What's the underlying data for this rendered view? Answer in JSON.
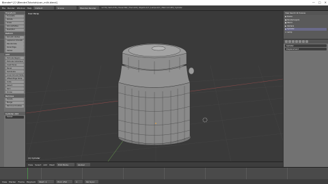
{
  "window": {
    "title": "Blender* [C:\\Blender\\Tutorials\\can_milk.blend]",
    "minimize": "—",
    "maximize": "□",
    "close": "✕"
  },
  "infobar": {
    "menus": [
      "File",
      "Render",
      "Window",
      "Help"
    ],
    "layout": "Default",
    "scene": "Scene",
    "engine": "Blender Render",
    "stats": "v2.79 | Verts:576 | Faces:560 | Tris:1120 | Objects:1/3 | Lamps:0/1 | Mem:12.14M | Cylinder"
  },
  "toolshelf": {
    "sections": [
      {
        "title": "Transform",
        "buttons": [
          "Translate",
          "Rotate",
          "Scale",
          "Shrink/Fatten",
          "Push/Pull"
        ]
      },
      {
        "title": "Deform",
        "buttons": [
          "Smooth Vertex",
          "Laplacian Smooth",
          "Randomize",
          "Slide Edge",
          "Vertex"
        ]
      },
      {
        "title": "Add",
        "buttons": [
          "Extrude Region",
          "Extrude Individual",
          "Inset Faces",
          "Bevel",
          "Subdivide",
          "Loop Cut and Slide",
          "Offset Edge Slide",
          "Knife",
          "Select",
          "Spin",
          "Screw"
        ]
      },
      {
        "title": "Remove",
        "buttons": [
          "Delete",
          "Merge",
          "Remove Doubles"
        ]
      }
    ],
    "operator_panel": "Cylinder Add",
    "operator_value": "Cursor"
  },
  "viewport": {
    "view_label": "User Persp",
    "object_label": "(1) Cylinder"
  },
  "viewport_header": {
    "items": [
      "View",
      "Select",
      "Add",
      "Mesh"
    ],
    "mode": "Edit Mode",
    "pivot": "Global"
  },
  "outliner": {
    "header": "View Search All Scenes",
    "rows": [
      {
        "label": "Scene",
        "selected": false
      },
      {
        "label": "RenderLayers",
        "selected": false
      },
      {
        "label": "World",
        "selected": false
      },
      {
        "label": "Camera",
        "selected": false
      },
      {
        "label": "Cylinder",
        "selected": true
      },
      {
        "label": "Lamp",
        "selected": false
      }
    ]
  },
  "properties": {
    "object_name": "Cylinder",
    "field": "Displacement"
  },
  "timeline": {
    "menus": [
      "View",
      "Marker",
      "Frame",
      "Playback"
    ],
    "start_label": "Start: 1",
    "end_label": "End: 250",
    "current_frame": "1",
    "sync": "No Sync"
  },
  "colors": {
    "viewport_bg": "#3a3a3a",
    "mesh": "#8c8c8c",
    "grid": "#454545",
    "axis_red": "#8a4a4a",
    "axis_green": "#5f8a4a"
  }
}
